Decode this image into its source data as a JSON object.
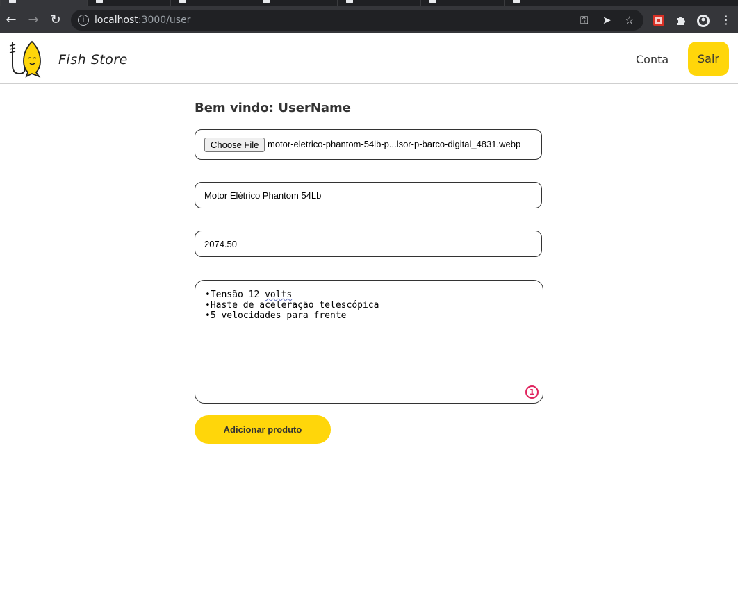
{
  "browser": {
    "url_host": "localhost",
    "url_rest": ":3000/user"
  },
  "header": {
    "brand": "Fish Store",
    "nav_account": "Conta",
    "logout_label": "Sair",
    "accent_color": "#ffd60a"
  },
  "main": {
    "welcome": "Bem vindo: UserName",
    "file_button": "Choose File",
    "file_name": "motor-eletrico-phantom-54lb-p...lsor-p-barco-digital_4831.webp",
    "product_name": "Motor Elétrico Phantom 54Lb",
    "price": "2074.50",
    "description_lines": [
      "•Tensão 12 ",
      "volts",
      "•Haste de aceleração telescópica",
      "•5 velocidades para frente"
    ],
    "issue_count": "1",
    "submit_label": "Adicionar produto"
  }
}
